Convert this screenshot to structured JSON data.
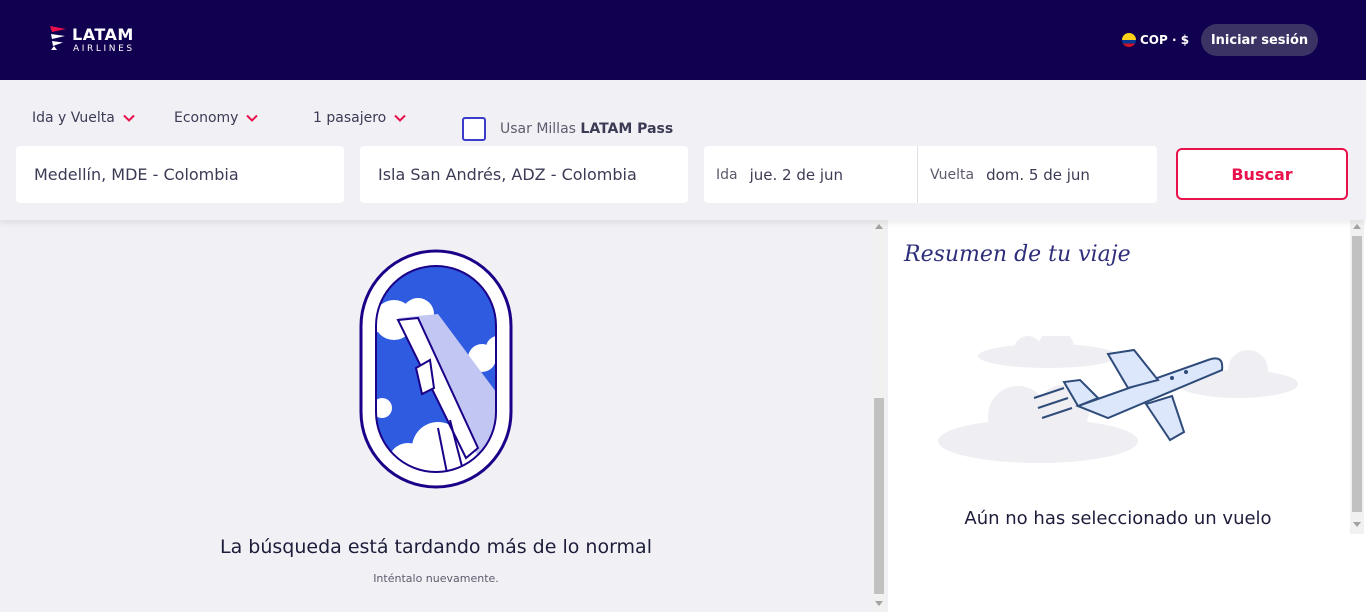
{
  "header": {
    "brand_name": "LATAM",
    "brand_sub": "AIRLINES",
    "currency": "COP · $",
    "login_label": "Iniciar sesión"
  },
  "search": {
    "trip_type": "Ida y Vuelta",
    "cabin": "Economy",
    "passengers": "1 pasajero",
    "miles_label_prefix": "Usar Millas",
    "miles_label_brand": "LATAM Pass",
    "origin": "Medellín, MDE - Colombia",
    "destination": "Isla San Andrés, ADZ - Colombia",
    "depart_label": "Ida",
    "depart_value": "jue. 2 de jun",
    "return_label": "Vuelta",
    "return_value": "dom. 5 de jun",
    "search_label": "Buscar"
  },
  "main": {
    "message": "La búsqueda está tardando más de lo normal",
    "retry_hint": "Inténtalo nuevamente."
  },
  "summary": {
    "title": "Resumen de tu viaje",
    "empty_message": "Aún no has seleccionado un vuelo"
  },
  "colors": {
    "header_bg": "#10004f",
    "accent": "#e8114b",
    "brand_blue": "#1b0088"
  }
}
